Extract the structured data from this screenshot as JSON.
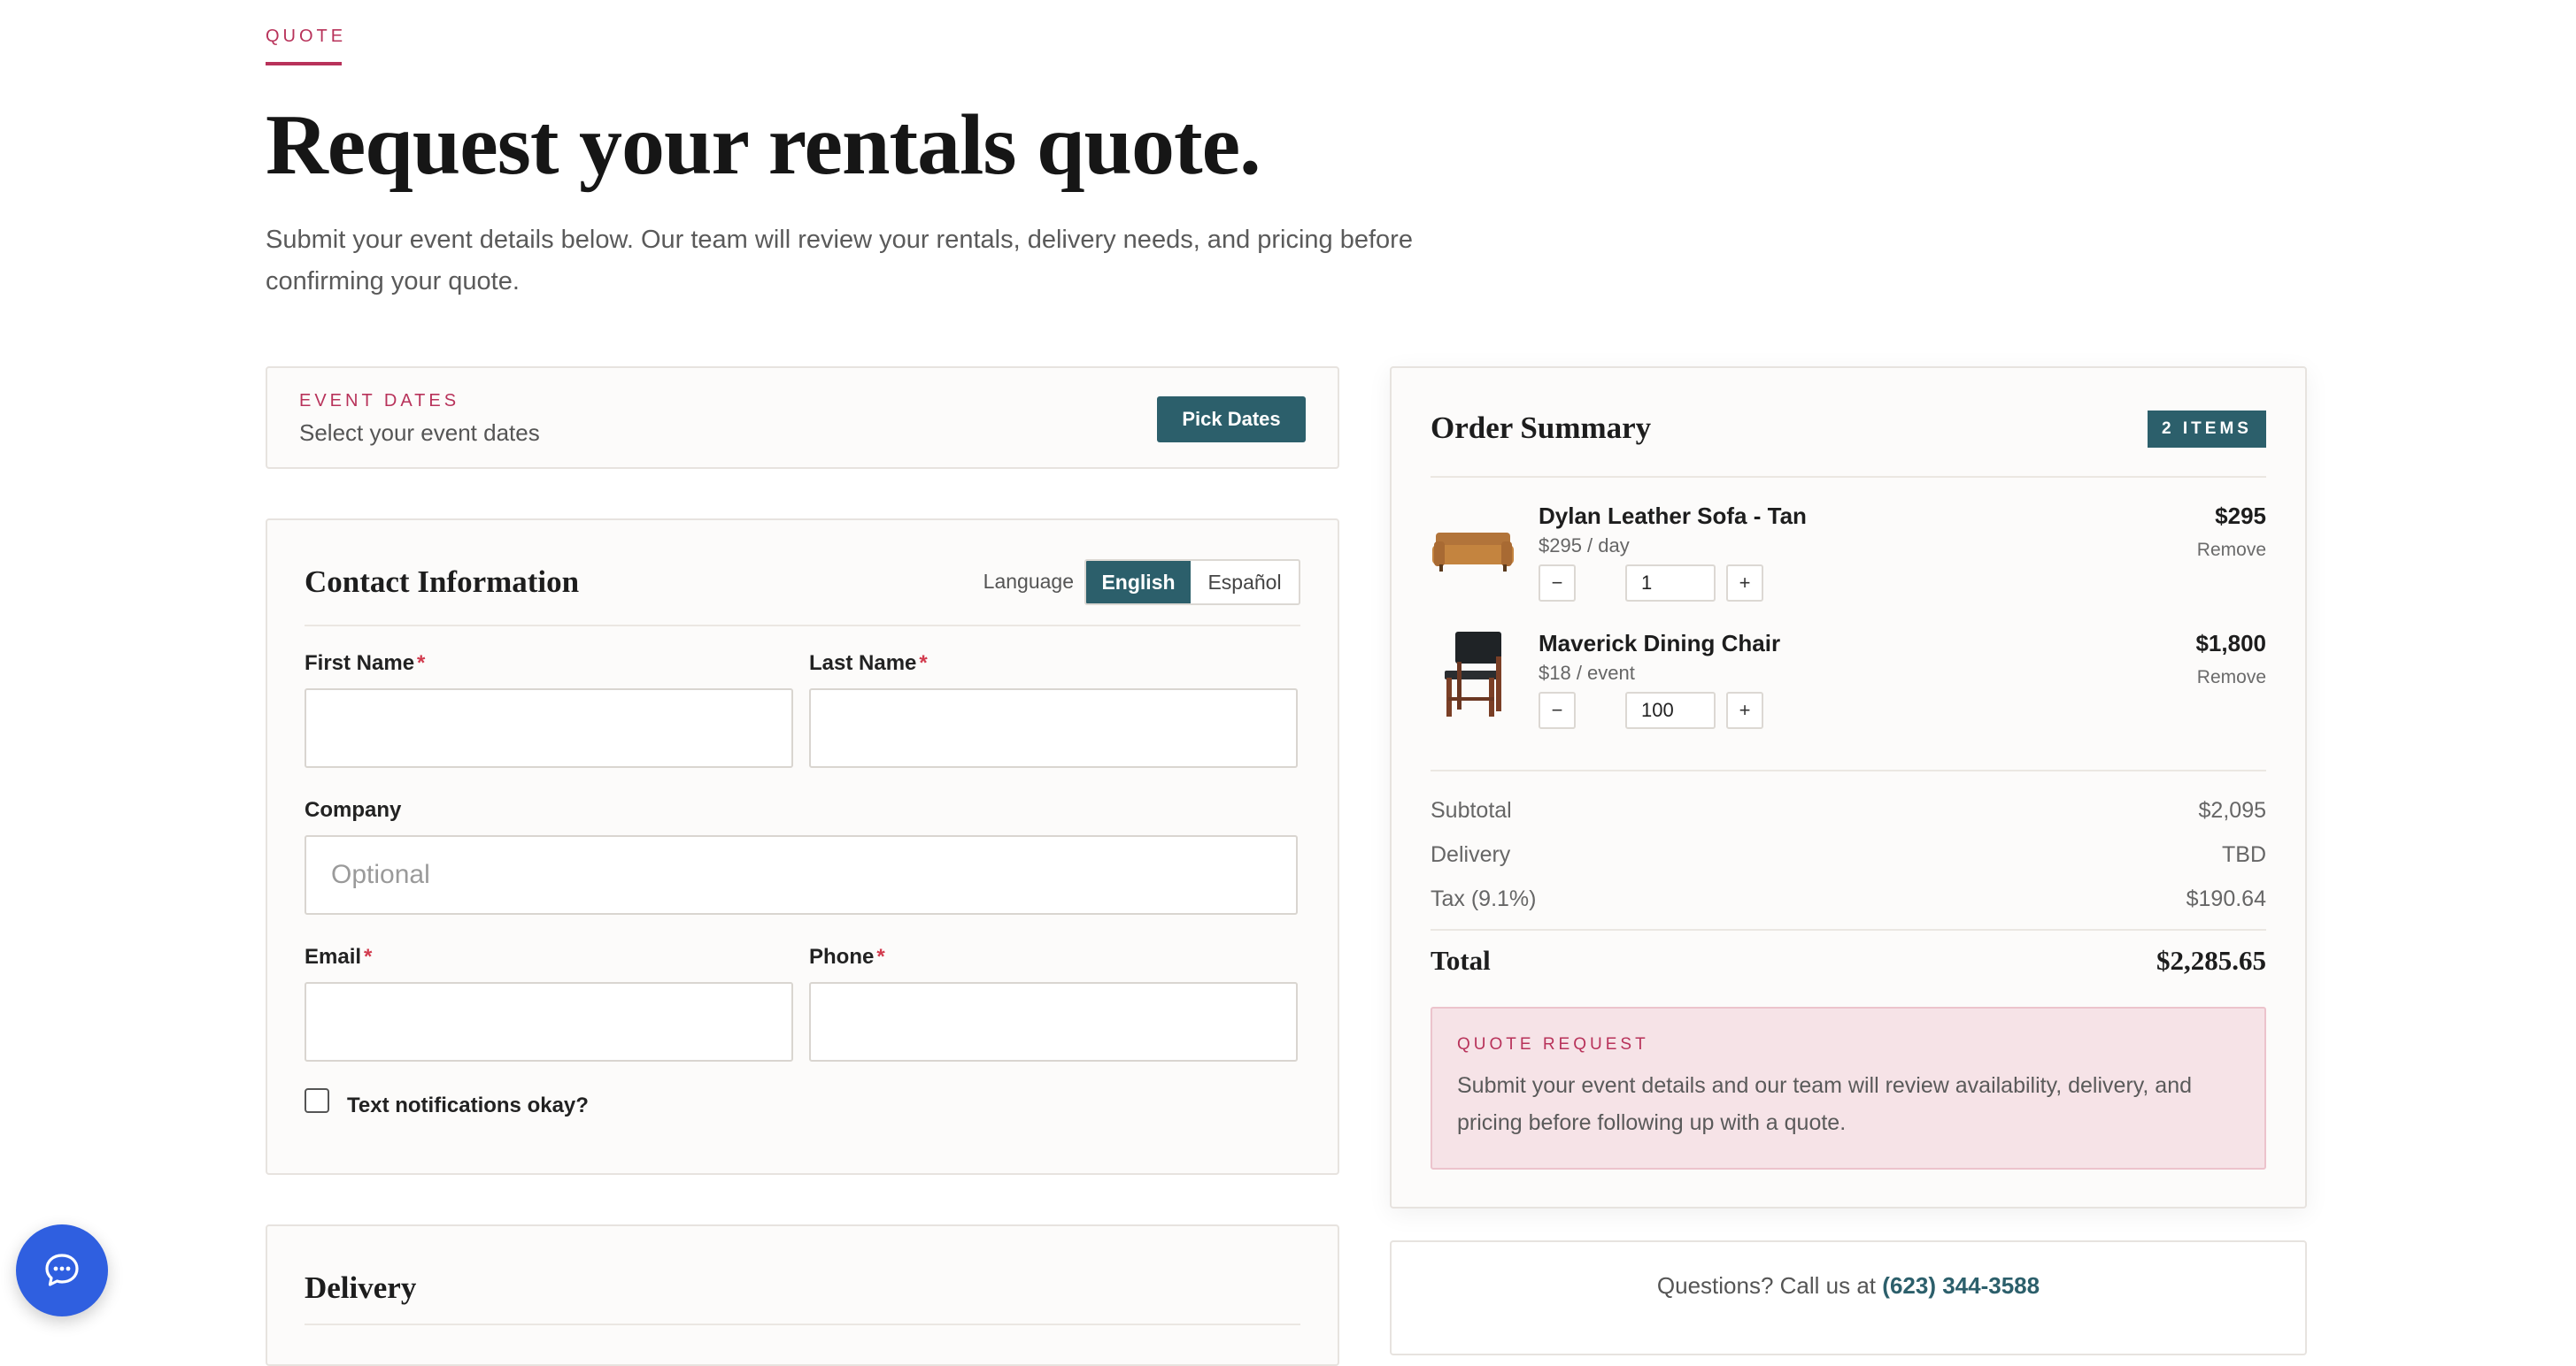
{
  "header": {
    "eyebrow": "QUOTE",
    "title": "Request your rentals quote.",
    "intro": "Submit your event details below. Our team will review your rentals, delivery needs, and pricing before confirming your quote."
  },
  "event_dates": {
    "label": "EVENT DATES",
    "subtitle": "Select your event dates",
    "button": "Pick Dates"
  },
  "contact": {
    "title": "Contact Information",
    "language_label": "Language",
    "languages": [
      "English",
      "Español"
    ],
    "selected_language": "English",
    "fields": {
      "first_name": {
        "label": "First Name",
        "required": "*",
        "value": ""
      },
      "last_name": {
        "label": "Last Name",
        "required": "*",
        "value": ""
      },
      "company": {
        "label": "Company",
        "placeholder": "Optional",
        "value": ""
      },
      "email": {
        "label": "Email",
        "required": "*",
        "value": ""
      },
      "phone": {
        "label": "Phone",
        "required": "*",
        "value": ""
      }
    },
    "text_notifications": {
      "label": "Text notifications okay?",
      "checked": false
    }
  },
  "delivery": {
    "title": "Delivery"
  },
  "summary": {
    "title": "Order Summary",
    "badge": "2 ITEMS",
    "items": [
      {
        "name": "Dylan Leather Sofa - Tan",
        "rate": "$295 / day",
        "qty": "1",
        "price": "$295",
        "remove": "Remove",
        "minus": "−",
        "plus": "+",
        "thumb_icon": "sofa-thumbnail"
      },
      {
        "name": "Maverick Dining Chair",
        "rate": "$18 / event",
        "qty": "100",
        "price": "$1,800",
        "remove": "Remove",
        "minus": "−",
        "plus": "+",
        "thumb_icon": "chair-thumbnail"
      }
    ],
    "subtotal": {
      "label": "Subtotal",
      "value": "$2,095"
    },
    "delivery": {
      "label": "Delivery",
      "value": "TBD"
    },
    "tax": {
      "label": "Tax (9.1%)",
      "value": "$190.64"
    },
    "total": {
      "label": "Total",
      "value": "$2,285.65"
    },
    "notice": {
      "label": "QUOTE REQUEST",
      "text": "Submit your event details and our team will review availability, delivery, and pricing before following up with a quote."
    }
  },
  "questions": {
    "text": "Questions? Call us at",
    "phone": "(623) 344-3588"
  },
  "chat": {
    "icon": "chat-icon"
  },
  "colors": {
    "accent": "#b8325a",
    "primary": "#2c5f6b",
    "chat": "#2f5fe0",
    "notice_bg": "#f6e3e7"
  }
}
